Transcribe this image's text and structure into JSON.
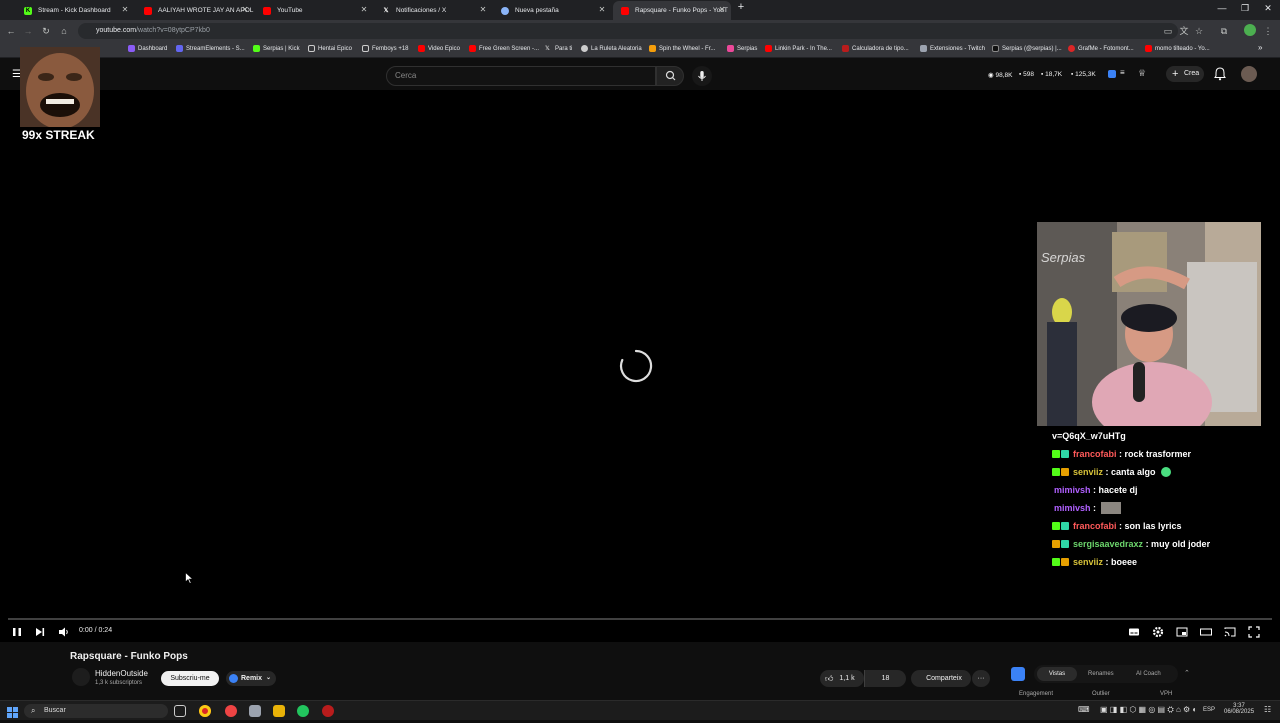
{
  "browser": {
    "tabs": [
      {
        "label": "Stream - Kick Dashboard",
        "color": "#53fc18"
      },
      {
        "label": "AALIYAH WROTE JAY AN APOL",
        "color": "#ff0000"
      },
      {
        "label": "YouTube",
        "color": "#ff0000"
      },
      {
        "label": "Notificaciones / X",
        "color": "#ffffff"
      },
      {
        "label": "Nueva pestaña",
        "color": "#8ab4f8"
      },
      {
        "label": "Rapsquare - Funko Pops - YouT",
        "color": "#ff0000"
      }
    ],
    "new_tab": "+",
    "url_host": "youtube.com",
    "url_path": "/watch?v=08ytpCP7kb0",
    "bookmarks": [
      "Dashboard",
      "StreamElements - S...",
      "Serpias | Kick",
      "Hentai Epico",
      "Femboys +18",
      "Video Epico",
      "Free Green Screen -...",
      "Para ti",
      "La Ruleta Aleatoria",
      "Spin the Wheel - Fr...",
      "Serpias",
      "Linkin Park - In The...",
      "Calculadora de tipo...",
      "Extensiones - Twitch",
      "Serpias (@serpias) |...",
      "GrafMe - Fotomont...",
      "momo tilteado - Yo..."
    ]
  },
  "youtube": {
    "search_placeholder": "Cerca",
    "stats": [
      "98,8K",
      "598",
      "18,7K",
      "125,3K"
    ],
    "create_label": "Crea"
  },
  "overlay": {
    "streak_text": "99x STREAK",
    "webcam_watermark": "Serpias"
  },
  "chat": [
    {
      "user": "",
      "message": "v=Q6qX_w7uHTg",
      "user_color": "#ffffff",
      "badges": []
    },
    {
      "user": "francofabi",
      "message": " : rock trasformer",
      "user_color": "#ff5a5a",
      "badges": [
        "#53fc18",
        "#2fd6a6"
      ]
    },
    {
      "user": "senviiz",
      "message": " : canta algo",
      "user_color": "#d8c33a",
      "badges": [
        "#53fc18",
        "#e6a000"
      ]
    },
    {
      "user": "mimivsh",
      "message": " : hacete dj",
      "user_color": "#b060ff",
      "badges": []
    },
    {
      "user": "mimivsh",
      "message": " : ",
      "user_color": "#b060ff",
      "badges": []
    },
    {
      "user": "francofabi",
      "message": " : son las lyrics",
      "user_color": "#ff5a5a",
      "badges": [
        "#53fc18",
        "#2fd6a6"
      ]
    },
    {
      "user": "sergisaavedraxz",
      "message": " : muy old joder",
      "user_color": "#6bd46b",
      "badges": [
        "#e6a000",
        "#2fd6a6"
      ]
    },
    {
      "user": "senviiz",
      "message": " : boeee",
      "user_color": "#d8c33a",
      "badges": [
        "#53fc18",
        "#e6a000"
      ]
    }
  ],
  "player": {
    "time": "0:00 / 0:24",
    "progress": 0.0
  },
  "video": {
    "title": "Rapsquare - Funko Pops",
    "channel": "HiddenOutside",
    "subscribers": "1,3 k subscriptors",
    "subscribe_label": "Subscriu-me",
    "remix_label": "Remix",
    "likes": "1,1 k",
    "dislikes": "18",
    "share_label": "Comparteix",
    "more_label": "···"
  },
  "vidiq": {
    "tabs": [
      "Vistas",
      "Renames",
      "AI Coach"
    ],
    "columns": [
      "Engagement",
      "Outlier",
      "VPH"
    ]
  },
  "taskbar": {
    "search_label": "Buscar",
    "lang": "ESP",
    "time": "3:37",
    "date": "06/08/2025"
  }
}
